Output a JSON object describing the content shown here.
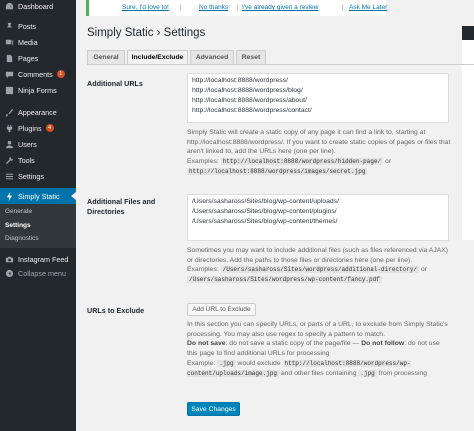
{
  "sidebar": {
    "items": [
      {
        "label": "Dashboard",
        "icon": "dashboard-icon"
      },
      {
        "label": "Posts",
        "icon": "pin-icon"
      },
      {
        "label": "Media",
        "icon": "media-icon"
      },
      {
        "label": "Pages",
        "icon": "pages-icon"
      },
      {
        "label": "Comments",
        "icon": "comment-icon",
        "badge": "1"
      },
      {
        "label": "Ninja Forms",
        "icon": "forms-icon"
      },
      {
        "label": "Appearance",
        "icon": "brush-icon"
      },
      {
        "label": "Plugins",
        "icon": "plug-icon",
        "badge": "4"
      },
      {
        "label": "Users",
        "icon": "user-icon"
      },
      {
        "label": "Tools",
        "icon": "wrench-icon"
      },
      {
        "label": "Settings",
        "icon": "settings-icon"
      },
      {
        "label": "Simply Static",
        "icon": "bolt-icon"
      },
      {
        "label": "Instagram Feed",
        "icon": "camera-icon"
      },
      {
        "label": "Collapse menu",
        "icon": "collapse-icon"
      }
    ],
    "submenu": [
      "Generate",
      "Settings",
      "Diagnostics"
    ]
  },
  "notice": {
    "links": [
      "Sure, I'd love to!",
      "No thanks",
      "I've already given a review",
      "Ask Me Later"
    ]
  },
  "page": {
    "title": "Simply Static › Settings",
    "tabs": [
      "General",
      "Include/Exclude",
      "Advanced",
      "Reset"
    ]
  },
  "additional_urls": {
    "label": "Additional URLs",
    "value": "http://localhost:8888/wordpress/\nhttp://localhost:8888/wordpress/blog/\nhttp://localhost:8888/wordpress/about/\nhttp://localhost:8888/wordpress/contact/",
    "desc": "Simply Static will create a static copy of any page it can find a link to, starting at http://localhost:8888/wordpress/. If you want to create static copies of pages or files that aren't linked to, add the URLs here (one per line).",
    "examples_label": "Examples:",
    "example1": "http://localhost:8888/wordpress/hidden-page/",
    "or": "or",
    "example2": "http://localhost:8888/wordpress/images/secret.jpg"
  },
  "additional_files": {
    "label": "Additional Files and Directories",
    "value": "/Users/sashaross/Sites/blog/wp-content/uploads/\n/Users/sashaross/Sites/blog/wp-content/plugins/\n/Users/sashaross/Sites/blog/wp-content/themes/",
    "desc": "Sometimes you may want to include additional files (such as files referenced via AJAX) or directories. Add the paths to those files or directories here (one per line).",
    "examples_label": "Examples:",
    "example1": "/Users/sashaross/Sites/wordpress/additional-directory/",
    "or": "or",
    "example2": "/Users/sashaross/Sites/wordpress/wp-content/fancy.pdf"
  },
  "exclude": {
    "label": "URLs to Exclude",
    "button": "Add URL to Exclude",
    "desc": "In this section you can specify URLs, or parts of a URL, to exclude from Simply Static's processing. You may also use regex to specify a pattern to match.",
    "do_not_save_label": "Do not save",
    "do_not_save_text": ": do not save a static copy of the page/file",
    "dash": " — ",
    "do_not_follow_label": "Do not follow",
    "do_not_follow_text": ": do not use this page to find additional URLs for processing",
    "example_label": "Example:",
    "example_jpg": ".jpg",
    "would_exclude": "would exclude",
    "example_url": "http://localhost:8888/wordpress/wp-content/uploads/image.jpg",
    "and_other": "and other files containing",
    "example_jpg2": ".jpg",
    "from_processing": "from processing"
  },
  "save_button": "Save Changes",
  "colors": {
    "sidebar_bg": "#23282d",
    "active_bg": "#0073aa",
    "primary_button": "#0085ba",
    "badge": "#d54e21",
    "notice_border": "#46b450"
  }
}
